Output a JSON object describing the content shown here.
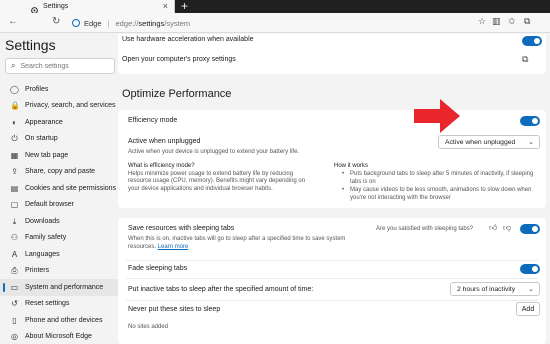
{
  "browser": {
    "tab_title": "Settings",
    "tab_close": "×",
    "new_tab": "+",
    "back": "←",
    "refresh": "↻",
    "brand": "Edge",
    "separator": "|",
    "url_prefix": "edge://",
    "url_bold": "settings",
    "url_suffix": "/system"
  },
  "sidebar": {
    "title": "Settings",
    "search_placeholder": "Search settings",
    "items": [
      {
        "label": "Profiles",
        "icon": "person-icon",
        "glyph": "◯"
      },
      {
        "label": "Privacy, search, and services",
        "icon": "lock-icon",
        "glyph": "🔒"
      },
      {
        "label": "Appearance",
        "icon": "palette-icon",
        "glyph": "◐"
      },
      {
        "label": "On startup",
        "icon": "power-icon",
        "glyph": "⏻"
      },
      {
        "label": "New tab page",
        "icon": "grid-icon",
        "glyph": "▦"
      },
      {
        "label": "Share, copy and paste",
        "icon": "share-icon",
        "glyph": "⇪"
      },
      {
        "label": "Cookies and site permissions",
        "icon": "cookie-icon",
        "glyph": "▤"
      },
      {
        "label": "Default browser",
        "icon": "browser-icon",
        "glyph": "▢"
      },
      {
        "label": "Downloads",
        "icon": "download-icon",
        "glyph": "⤓"
      },
      {
        "label": "Family safety",
        "icon": "family-icon",
        "glyph": "⚇"
      },
      {
        "label": "Languages",
        "icon": "language-icon",
        "glyph": "A"
      },
      {
        "label": "Printers",
        "icon": "printer-icon",
        "glyph": "⎙"
      },
      {
        "label": "System and performance",
        "icon": "system-icon",
        "glyph": "▭"
      },
      {
        "label": "Reset settings",
        "icon": "reset-icon",
        "glyph": "↺"
      },
      {
        "label": "Phone and other devices",
        "icon": "phone-icon",
        "glyph": "▯"
      },
      {
        "label": "About Microsoft Edge",
        "icon": "edge-icon",
        "glyph": "◎"
      }
    ],
    "active_index": 12
  },
  "main": {
    "hw_accel_label": "Use hardware acceleration when available",
    "proxy_label": "Open your computer's proxy settings",
    "section_title": "Optimize Performance",
    "efficiency": {
      "title": "Efficiency mode",
      "active_label": "Active when unplugged",
      "active_desc": "Active when your device is unplugged to extend your battery life.",
      "dropdown_value": "Active when unplugged",
      "what_title": "What is efficiency mode?",
      "what_desc": "Helps minimize power usage to extend battery life by reducing resource usage (CPU, memory). Benefits might vary depending on your device applications and individual browser habits.",
      "how_title": "How it works",
      "how_bullet_1": "Puts background tabs to sleep after 5 minutes of inactivity, if sleeping tabs is on",
      "how_bullet_2": "May cause videos to be less smooth, animations to slow down when you're not interacting with the browser"
    },
    "sleeping": {
      "title": "Save resources with sleeping tabs",
      "desc": "When this is on, inactive tabs will go to sleep after a specified time to save system resources.",
      "learn_more": "Learn more",
      "feedback_q": "Are you satisfied with sleeping tabs?",
      "fade_label": "Fade sleeping tabs",
      "sleep_after_label": "Put inactive tabs to sleep after the specified amount of time:",
      "sleep_after_value": "2 hours of inactivity",
      "never_label": "Never put these sites to sleep",
      "add_button": "Add",
      "no_sites": "No sites added"
    }
  },
  "colors": {
    "accent": "#0f6cbd",
    "arrow": "#e8262b"
  }
}
